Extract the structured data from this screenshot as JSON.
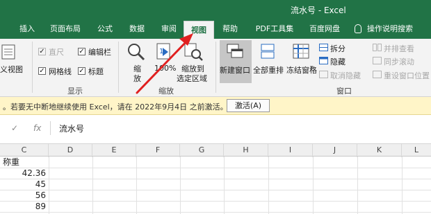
{
  "window": {
    "title": "流水号 - Excel"
  },
  "tabs": [
    {
      "label": "插入"
    },
    {
      "label": "页面布局"
    },
    {
      "label": "公式"
    },
    {
      "label": "数据"
    },
    {
      "label": "审阅"
    },
    {
      "label": "视图",
      "active": true
    },
    {
      "label": "帮助"
    },
    {
      "label": "PDF工具集"
    },
    {
      "label": "百度网盘"
    },
    {
      "label": "操作说明搜索"
    }
  ],
  "ribbon": {
    "workbook_view_label": "义视图",
    "show_group": {
      "label": "显示",
      "ruler": {
        "label": "直尺",
        "checked": true,
        "disabled": true
      },
      "formula_bar": {
        "label": "编辑栏",
        "checked": true
      },
      "gridlines": {
        "label": "网格线",
        "checked": true
      },
      "headings": {
        "label": "标题",
        "checked": true
      }
    },
    "zoom_group": {
      "label": "缩放",
      "zoom_line1": "缩",
      "zoom_line2": "放",
      "zoom_100": "100%",
      "zoom_sel_line1": "缩放到",
      "zoom_sel_line2": "选定区域"
    },
    "window_group": {
      "label": "窗口",
      "new_window": "新建窗口",
      "arrange_all": "全部重排",
      "freeze_panes": "冻结窗格",
      "split": "拆分",
      "hide": "隐藏",
      "unhide": "取消隐藏",
      "view_side_by_side": "并排查看",
      "sync_scroll": "同步滚动",
      "reset_position": "重设窗口位置"
    }
  },
  "notification": {
    "message": "。若要无中断地继续使用 Excel，请在 2022年9月4日 之前激活。",
    "button": "激活(A)"
  },
  "formula_bar": {
    "cancel_icon": "✓",
    "fx_label": "fx",
    "value": "流水号"
  },
  "sheet": {
    "columns": [
      "C",
      "D",
      "E",
      "F",
      "G",
      "H",
      "I",
      "J",
      "K",
      "L"
    ],
    "cells": [
      "称重",
      "42.36",
      "45",
      "56",
      "89"
    ]
  },
  "colors": {
    "accent": "#217346",
    "arrow": "#e02020"
  }
}
